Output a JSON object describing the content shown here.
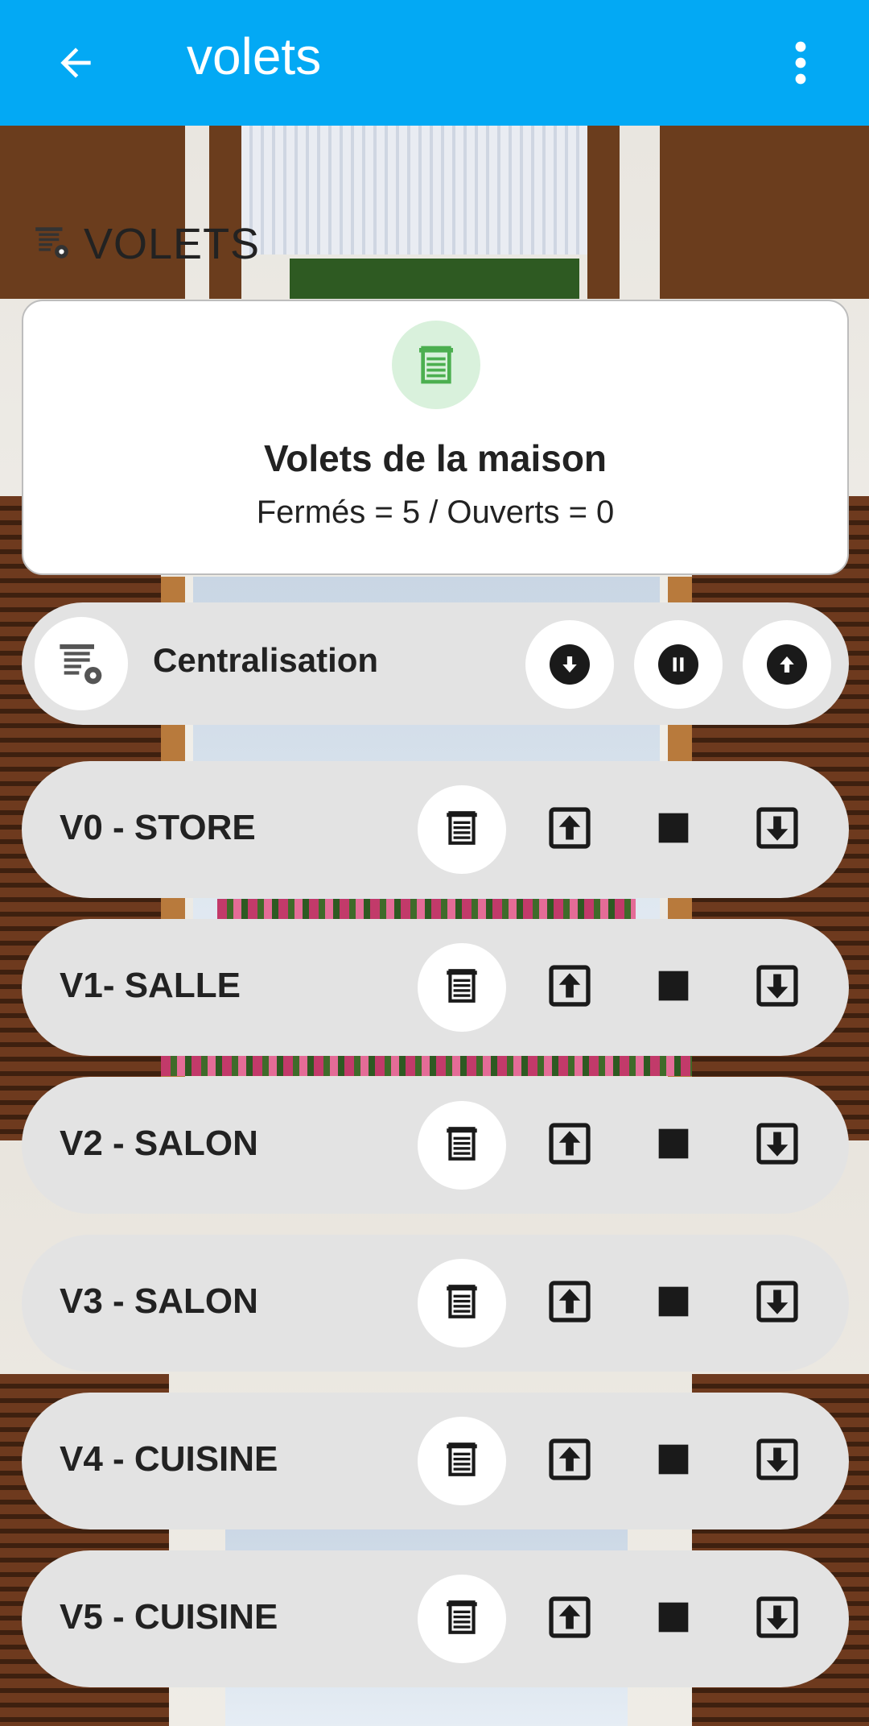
{
  "app_bar": {
    "title": "volets",
    "back_icon": "arrow-back-icon",
    "menu_icon": "more-vertical-icon",
    "color": "#03a9f4"
  },
  "section": {
    "label": "VOLETS",
    "icon": "shutter-settings-icon"
  },
  "summary": {
    "icon": "shutter-icon",
    "icon_color": "#4caf50",
    "title": "Volets de la maison",
    "status": "Fermés = 5 / Ouverts = 0"
  },
  "centralisation": {
    "label": "Centralisation",
    "icon": "shutter-settings-icon",
    "buttons": [
      {
        "icon": "arrow-down-circle-icon"
      },
      {
        "icon": "pause-circle-icon"
      },
      {
        "icon": "arrow-up-circle-icon"
      }
    ]
  },
  "shutters": [
    {
      "label": "V0 - STORE"
    },
    {
      "label": "V1- SALLE"
    },
    {
      "label": "V2 - SALON"
    },
    {
      "label": "V3 - SALON"
    },
    {
      "label": "V4 - CUISINE"
    },
    {
      "label": "V5 - CUISINE"
    }
  ],
  "shutter_actions": {
    "status_icon": "shutter-icon",
    "up_icon": "arrow-up-box-icon",
    "stop_icon": "stop-square-icon",
    "down_icon": "arrow-down-box-icon"
  }
}
